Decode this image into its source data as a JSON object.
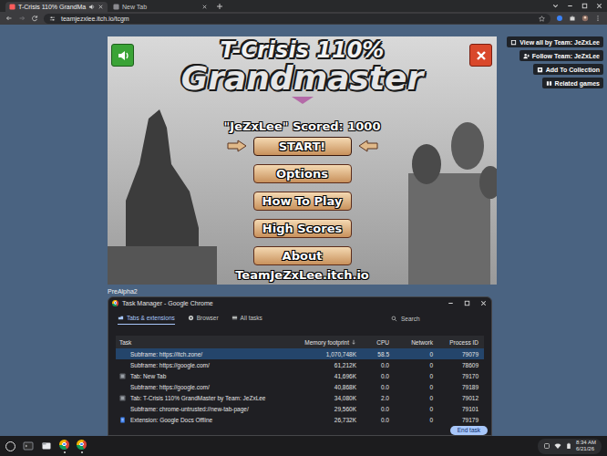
{
  "browser": {
    "tabs": [
      {
        "label": "T-Crisis 110% GrandMa",
        "selected": true,
        "audio": true
      },
      {
        "label": "New Tab",
        "selected": false,
        "audio": false
      }
    ],
    "url": "teamjezxlee.itch.io/tcgm"
  },
  "page": {
    "user_tools": [
      "View all by Team: JeZxLee",
      "Follow Team: JeZxLee",
      "Add To Collection",
      "Related games"
    ],
    "game": {
      "title": [
        "T-Crisis 110%",
        "Grandmaster"
      ],
      "score": "\"JeZxLee\" Scored: 1000",
      "sound_on": true,
      "menu": [
        {
          "label": "START!",
          "selected": true
        },
        {
          "label": "Options",
          "selected": false
        },
        {
          "label": "How To Play",
          "selected": false
        },
        {
          "label": "High Scores",
          "selected": false
        },
        {
          "label": "About",
          "selected": false
        }
      ],
      "footer": "TeamJeZxLee.itch.io"
    },
    "caption": "PreAlpha2"
  },
  "task_manager": {
    "title": "Task Manager - Google Chrome",
    "tabs": [
      {
        "label": "Tabs & extensions",
        "selected": true
      },
      {
        "label": "Browser",
        "selected": false
      },
      {
        "label": "All tasks",
        "selected": false
      }
    ],
    "search": {
      "placeholder": "Search"
    },
    "columns": [
      {
        "label": "Task",
        "sorted": false
      },
      {
        "label": "Memory footprint",
        "sorted": true
      },
      {
        "label": "CPU",
        "sorted": false
      },
      {
        "label": "Network",
        "sorted": false
      },
      {
        "label": "Process ID",
        "sorted": false
      }
    ],
    "rows": [
      {
        "kind": "subframe",
        "task": "Subframe: https://itch.zone/",
        "memory": "1,070,748K",
        "cpu": "58.5",
        "network": "0",
        "pid": "79079",
        "selected": true
      },
      {
        "kind": "subframe",
        "task": "Subframe: https://google.com/",
        "memory": "61,212K",
        "cpu": "0.0",
        "network": "0",
        "pid": "78609",
        "selected": false
      },
      {
        "kind": "tab",
        "task": "Tab: New Tab",
        "memory": "41,696K",
        "cpu": "0.0",
        "network": "0",
        "pid": "79170",
        "selected": false
      },
      {
        "kind": "subframe",
        "task": "Subframe: https://google.com/",
        "memory": "40,868K",
        "cpu": "0.0",
        "network": "0",
        "pid": "79189",
        "selected": false
      },
      {
        "kind": "tab",
        "task": "Tab: T-Crisis 110% GrandMaster by Team: JeZxLee",
        "memory": "34,080K",
        "cpu": "2.0",
        "network": "0",
        "pid": "79012",
        "selected": false
      },
      {
        "kind": "subframe",
        "task": "Subframe: chrome-untrusted://new-tab-page/",
        "memory": "29,560K",
        "cpu": "0.0",
        "network": "0",
        "pid": "79101",
        "selected": false
      },
      {
        "kind": "extension",
        "task": "Extension: Google Docs Offline",
        "memory": "26,732K",
        "cpu": "0.0",
        "network": "0",
        "pid": "79179",
        "selected": false
      }
    ],
    "button": "End task"
  },
  "shelf": {
    "time": "8:34 AM",
    "date": "6/21/26"
  }
}
